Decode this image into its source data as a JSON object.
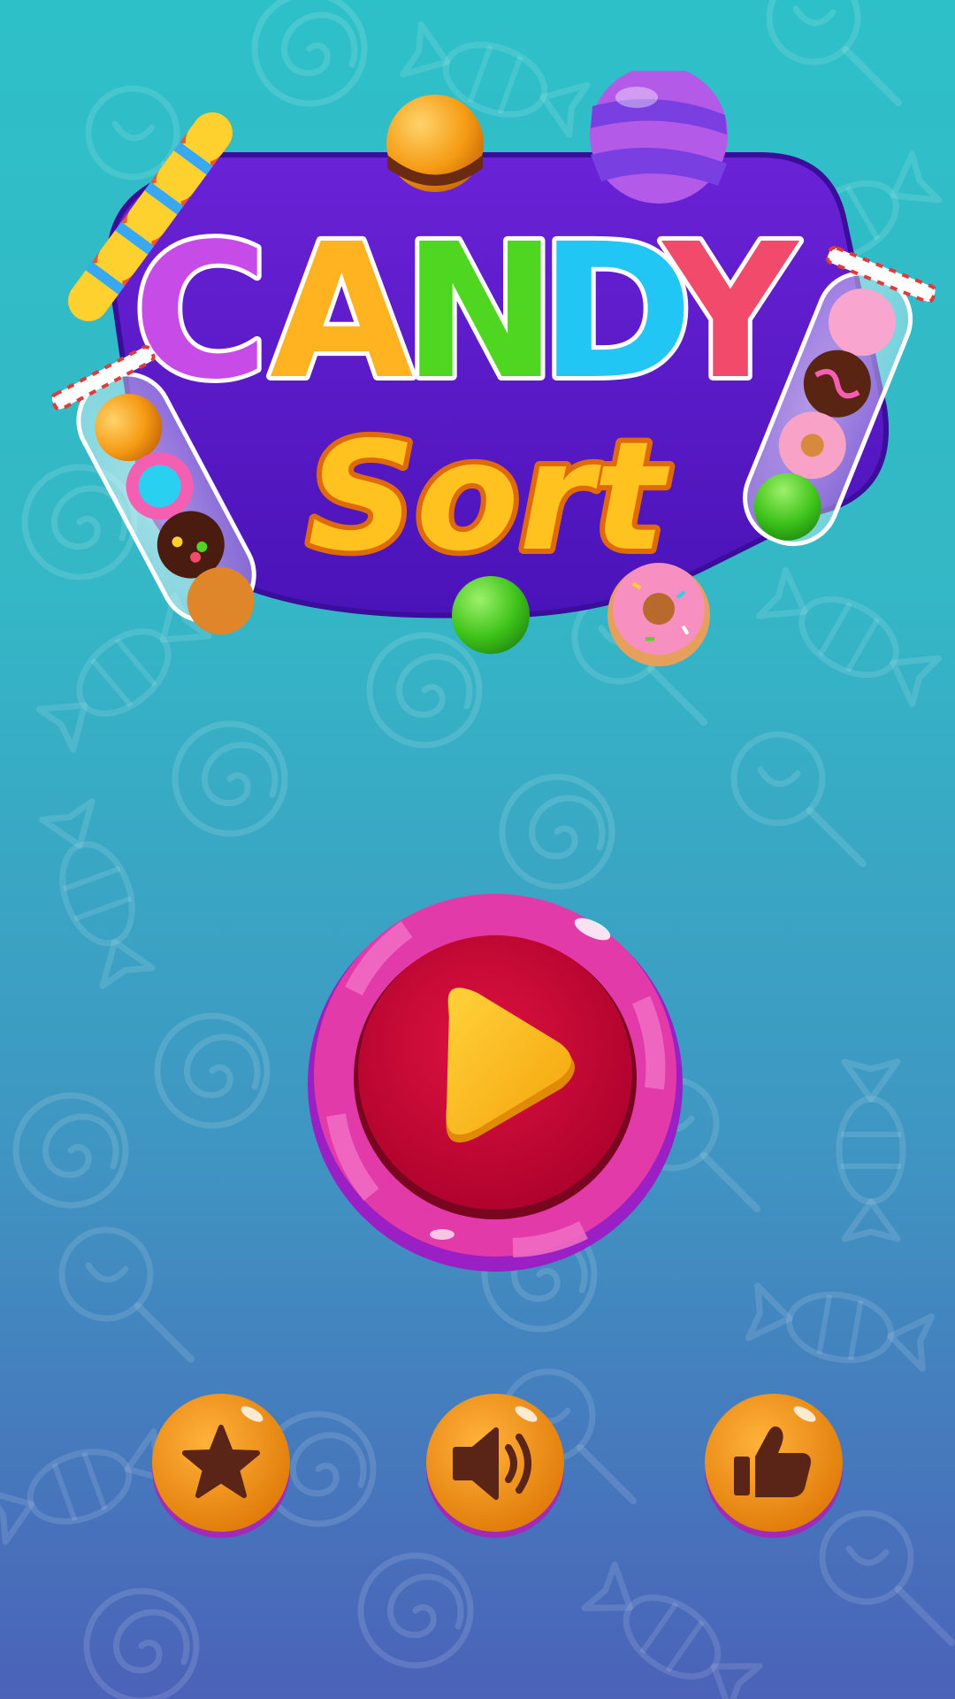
{
  "game": {
    "title_line1": "CANDY",
    "title_line2": "Sort"
  },
  "colors": {
    "background_top": "#2ec0c8",
    "background_bottom": "#4b62b8",
    "logo_plate": "#5517c4",
    "play_ring": "#e23aa8",
    "play_inner": "#c8002f",
    "play_triangle": "#ffbf1f",
    "small_button": "#f08a0c",
    "small_button_icon": "#5a2416",
    "title_letters": [
      "#c74be6",
      "#ffb320",
      "#4fd620",
      "#21c6f5",
      "#f14a6a"
    ]
  },
  "buttons": {
    "play": {
      "icon": "play-icon"
    },
    "rate": {
      "icon": "star-icon"
    },
    "sound": {
      "icon": "speaker-icon"
    },
    "like": {
      "icon": "thumbs-up-icon"
    }
  }
}
